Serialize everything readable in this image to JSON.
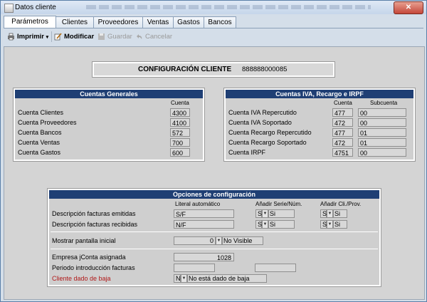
{
  "window": {
    "title": "Datos cliente",
    "close_label": "✕"
  },
  "tabs": [
    "Parámetros",
    "Clientes",
    "Proveedores",
    "Ventas",
    "Gastos",
    "Bancos"
  ],
  "toolbar": {
    "print": "Imprimir",
    "modify": "Modificar",
    "save": "Guardar",
    "cancel": "Cancelar"
  },
  "config": {
    "title": "CONFIGURACIÓN CLIENTE",
    "code": "888888000085"
  },
  "general": {
    "title": "Cuentas Generales",
    "col_header": "Cuenta",
    "rows": [
      {
        "label": "Cuenta Clientes",
        "value": "4300"
      },
      {
        "label": "Cuenta Proveedores",
        "value": "4100"
      },
      {
        "label": "Cuenta Bancos",
        "value": "572"
      },
      {
        "label": "Cuenta Ventas",
        "value": "700"
      },
      {
        "label": "Cuenta Gastos",
        "value": "600"
      }
    ]
  },
  "iva": {
    "title": "Cuentas IVA, Recargo e IRPF",
    "col_cuenta": "Cuenta",
    "col_sub": "Subcuenta",
    "rows": [
      {
        "label": "Cuenta IVA Repercutido",
        "cuenta": "477",
        "sub": "00"
      },
      {
        "label": "Cuenta IVA Soportado",
        "cuenta": "472",
        "sub": "00"
      },
      {
        "label": "Cuenta Recargo Repercutido",
        "cuenta": "477",
        "sub": "01"
      },
      {
        "label": "Cuenta Recargo Soportado",
        "cuenta": "472",
        "sub": "01"
      },
      {
        "label": "Cuenta IRPF",
        "cuenta": "4751",
        "sub": "00"
      }
    ]
  },
  "options": {
    "title": "Opciones de configuración",
    "col_literal": "Literal automático",
    "col_serie": "Añadir Serie/Núm.",
    "col_cif": "Añadir Cli./Prov.",
    "emitidas": {
      "label": "Descripción facturas emitidas",
      "literal": "S/F",
      "serie_code": "S",
      "serie_text": "Si",
      "cif_code": "S",
      "cif_text": "Si"
    },
    "recibidas": {
      "label": "Descripción facturas recibidas",
      "literal": "N/F",
      "serie_code": "S",
      "serie_text": "Si",
      "cif_code": "S",
      "cif_text": "Si"
    },
    "pantalla": {
      "label": "Mostrar pantalla inicial",
      "code": "0",
      "text": "No Visible"
    },
    "empresa": {
      "label": "Empresa jConta asignada",
      "value": "1028"
    },
    "periodo": {
      "label": "Periodo introducción facturas",
      "from": "",
      "to": ""
    },
    "baja": {
      "label": "Cliente dado de baja",
      "code": "N",
      "text": "No está dado de baja"
    }
  }
}
